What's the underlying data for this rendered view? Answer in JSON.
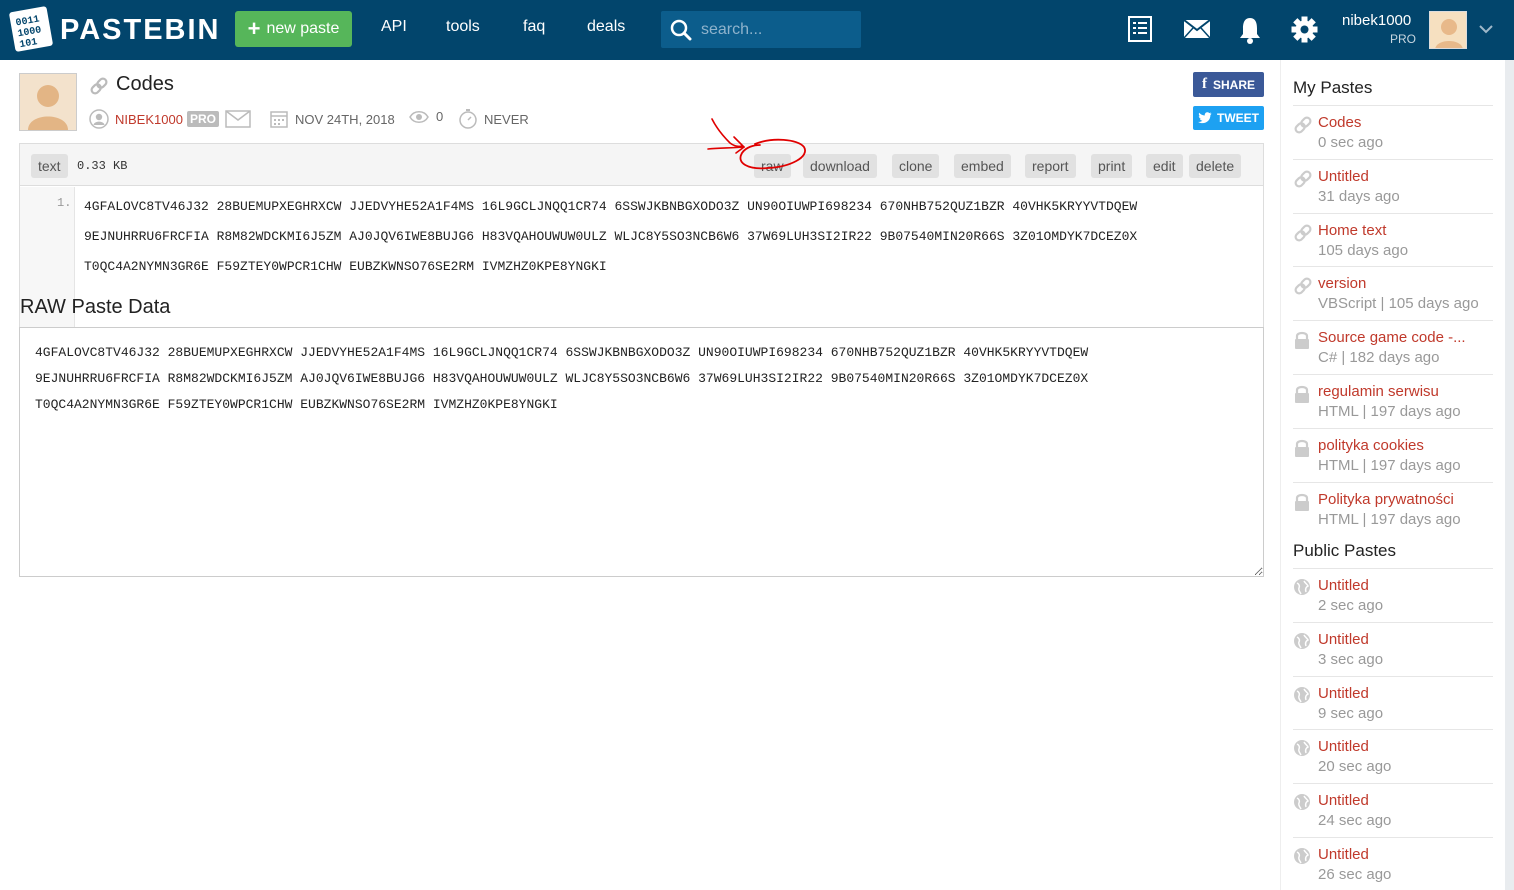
{
  "header": {
    "logo_text": "PASTEBIN",
    "new_paste_label": "new paste",
    "nav": [
      "API",
      "tools",
      "faq",
      "deals"
    ],
    "search_placeholder": "search...",
    "user_name": "nibek1000",
    "user_level": "PRO"
  },
  "paste": {
    "title": "Codes",
    "author": "NIBEK1000",
    "author_badge": "PRO",
    "date": "NOV 24TH, 2018",
    "views": "0",
    "expiry": "NEVER",
    "share_label": "SHARE",
    "tweet_label": "TWEET",
    "syntax": "text",
    "size": "0.33 KB",
    "actions": [
      "raw",
      "download",
      "clone",
      "embed",
      "report",
      "print",
      "edit",
      "delete"
    ],
    "line_number": "1.",
    "code_lines": [
      "4GFALOVC8TV46J32 28BUEMUPXEGHRXCW JJEDVYHE52A1F4MS 16L9GCLJNQQ1CR74 6SSWJKBNBGXODO3Z UN90OIUWPI698234 670NHB752QUZ1BZR 40VHK5KRYYVTDQEW",
      "9EJNUHRRU6FRCFIA R8M82WDCKMI6J5ZM AJ0JQV6IWE8BUJG6 H83VQAHOUWUW0ULZ WLJC8Y5SO3NCB6W6 37W69LUH3SI2IR22 9B07540MIN20R66S 3Z01OMDYK7DCEZ0X",
      "T0QC4A2NYMN3GR6E F59ZTEY0WPCR1CHW EUBZKWNSO76SE2RM IVMZHZ0KPE8YNGKI"
    ],
    "raw_heading": "RAW Paste Data",
    "raw_text": "4GFALOVC8TV46J32 28BUEMUPXEGHRXCW JJEDVYHE52A1F4MS 16L9GCLJNQQ1CR74 6SSWJKBNBGXODO3Z UN90OIUWPI698234 670NHB752QUZ1BZR 40VHK5KRYYVTDQEW\n9EJNUHRRU6FRCFIA R8M82WDCKMI6J5ZM AJ0JQV6IWE8BUJG6 H83VQAHOUWUW0ULZ WLJC8Y5SO3NCB6W6 37W69LUH3SI2IR22 9B07540MIN20R66S 3Z01OMDYK7DCEZ0X\nT0QC4A2NYMN3GR6E F59ZTEY0WPCR1CHW EUBZKWNSO76SE2RM IVMZHZ0KPE8YNGKI"
  },
  "sidebar": {
    "my_pastes_heading": "My Pastes",
    "my_pastes": [
      {
        "title": "Codes",
        "sub": "0 sec ago",
        "icon": "link-icon"
      },
      {
        "title": "Untitled",
        "sub": "31 days ago",
        "icon": "link-icon"
      },
      {
        "title": "Home text",
        "sub": "105 days ago",
        "icon": "link-icon"
      },
      {
        "title": "version",
        "sub": "VBScript | 105 days ago",
        "icon": "link-icon"
      },
      {
        "title": "Source game code -...",
        "sub": "C# | 182 days ago",
        "icon": "lock-icon"
      },
      {
        "title": "regulamin serwisu",
        "sub": "HTML | 197 days ago",
        "icon": "lock-icon"
      },
      {
        "title": "polityka cookies",
        "sub": "HTML | 197 days ago",
        "icon": "lock-icon"
      },
      {
        "title": "Polityka prywatności",
        "sub": "HTML | 197 days ago",
        "icon": "lock-icon"
      }
    ],
    "public_pastes_heading": "Public Pastes",
    "public_pastes": [
      {
        "title": "Untitled",
        "sub": "2 sec ago",
        "icon": "globe-icon"
      },
      {
        "title": "Untitled",
        "sub": "3 sec ago",
        "icon": "globe-icon"
      },
      {
        "title": "Untitled",
        "sub": "9 sec ago",
        "icon": "globe-icon"
      },
      {
        "title": "Untitled",
        "sub": "20 sec ago",
        "icon": "globe-icon"
      },
      {
        "title": "Untitled",
        "sub": "24 sec ago",
        "icon": "globe-icon"
      },
      {
        "title": "Untitled",
        "sub": "26 sec ago",
        "icon": "globe-icon"
      }
    ]
  },
  "colors": {
    "header_bg": "#02456c",
    "new_paste_bg": "#56b65a",
    "link_red": "#c0392b",
    "annotation_red": "#e00000"
  }
}
